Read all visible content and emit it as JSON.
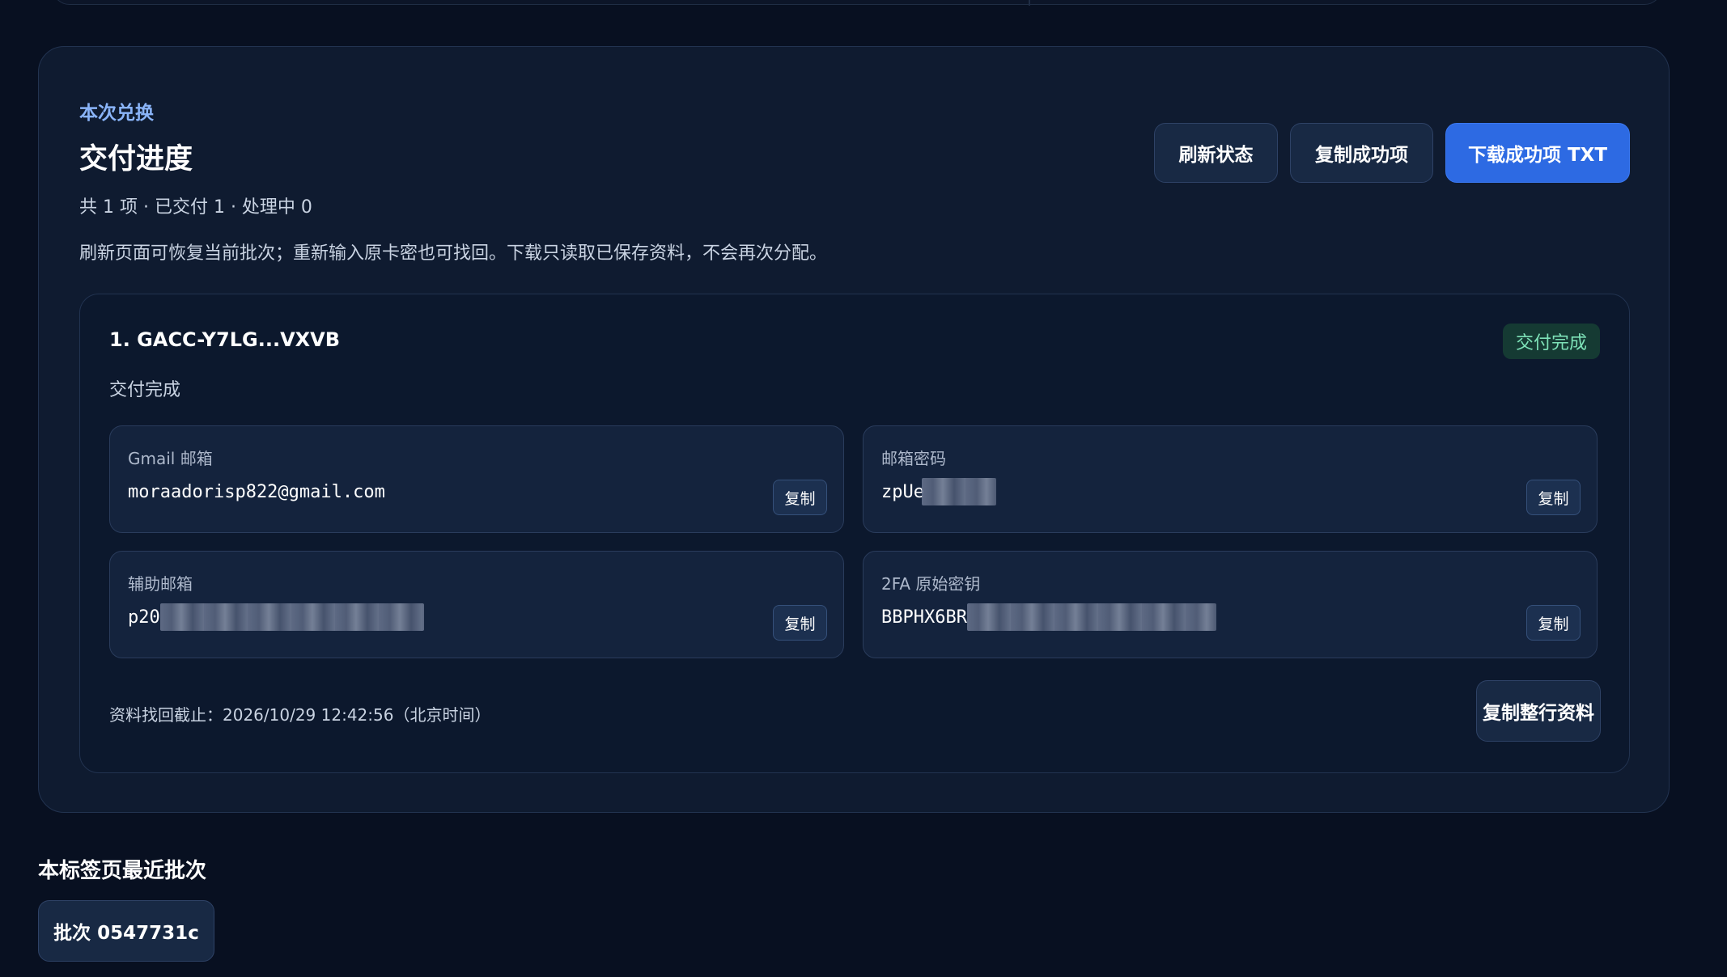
{
  "panel": {
    "eyebrow": "本次兑换",
    "title": "交付进度",
    "summary": "共 1 项 · 已交付 1 · 处理中 0",
    "notice": "刷新页面可恢复当前批次；重新输入原卡密也可找回。下载只读取已保存资料，不会再次分配。",
    "buttons": {
      "refresh": "刷新状态",
      "copy_success": "复制成功项",
      "download": "下载成功项 TXT"
    }
  },
  "item": {
    "title": "1. GACC-Y7LG...VXVB",
    "subtitle": "交付完成",
    "status_badge": "交付完成",
    "status_color": "#7ee2b8",
    "fields": {
      "gmail": {
        "label": "Gmail 邮箱",
        "value": "moraadorisp822@gmail.com"
      },
      "password": {
        "label": "邮箱密码",
        "value": "zpUe"
      },
      "recovery": {
        "label": "辅助邮箱",
        "value": "p20"
      },
      "twofa": {
        "label": "2FA 原始密钥",
        "value": "BBPHX6BR"
      }
    },
    "copy_label": "复制",
    "deadline": "资料找回截止：2026/10/29 12:42:56（北京时间）",
    "copy_row_label": "复制整行资料"
  },
  "recent": {
    "title": "本标签页最近批次",
    "batch_label": "批次 0547731c"
  },
  "colors": {
    "background": "#081021",
    "panel": "#0f1b30",
    "primary_button": "#2d6ae3",
    "accent_text": "#8ab4f8"
  }
}
